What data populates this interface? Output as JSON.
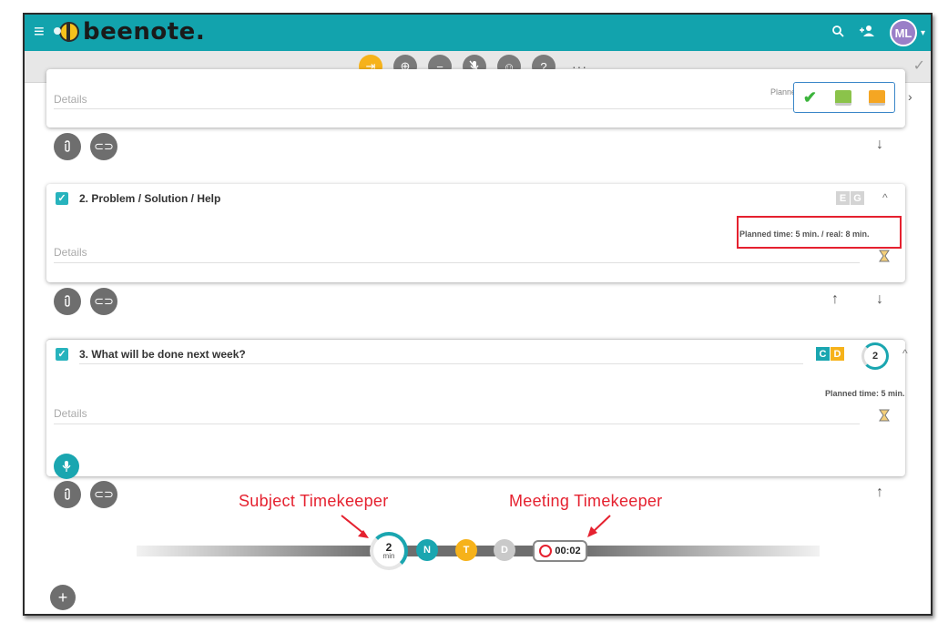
{
  "topbar": {
    "menu_icon": "hamburger-icon",
    "logo_text": "beenote.",
    "search_icon": "search-icon",
    "add_user_icon": "add-user-icon",
    "avatar_initials": "ML",
    "color": "#12a3ad"
  },
  "toolbar": {
    "tools": [
      "exit-icon",
      "zoom-icon",
      "minus-icon",
      "mic-off-icon",
      "face-icon",
      "help-icon"
    ],
    "more_label": "···",
    "done_icon": "check-icon"
  },
  "item1": {
    "details_placeholder": "Details",
    "planned_time_partial": "Planned time: 5 min. / real: 8 min."
  },
  "item2": {
    "title": "2. Problem / Solution / Help",
    "letters": [
      "E",
      "G"
    ],
    "details_placeholder": "Details",
    "planned_time": "Planned time: 5 min. / real: 8 min."
  },
  "item3": {
    "title": "3. What will be done next week?",
    "letters": [
      "C",
      "D"
    ],
    "timer": "2",
    "details_placeholder": "Details",
    "planned_time": "Planned time: 5 min."
  },
  "annotations": {
    "subject": "Subject  Timekeeper",
    "meeting": "Meeting  Timekeeper"
  },
  "timeline": {
    "subject_minutes": "2",
    "subject_unit": "min",
    "dots": [
      "N",
      "T",
      "D"
    ],
    "meeting_time": "00:02"
  }
}
